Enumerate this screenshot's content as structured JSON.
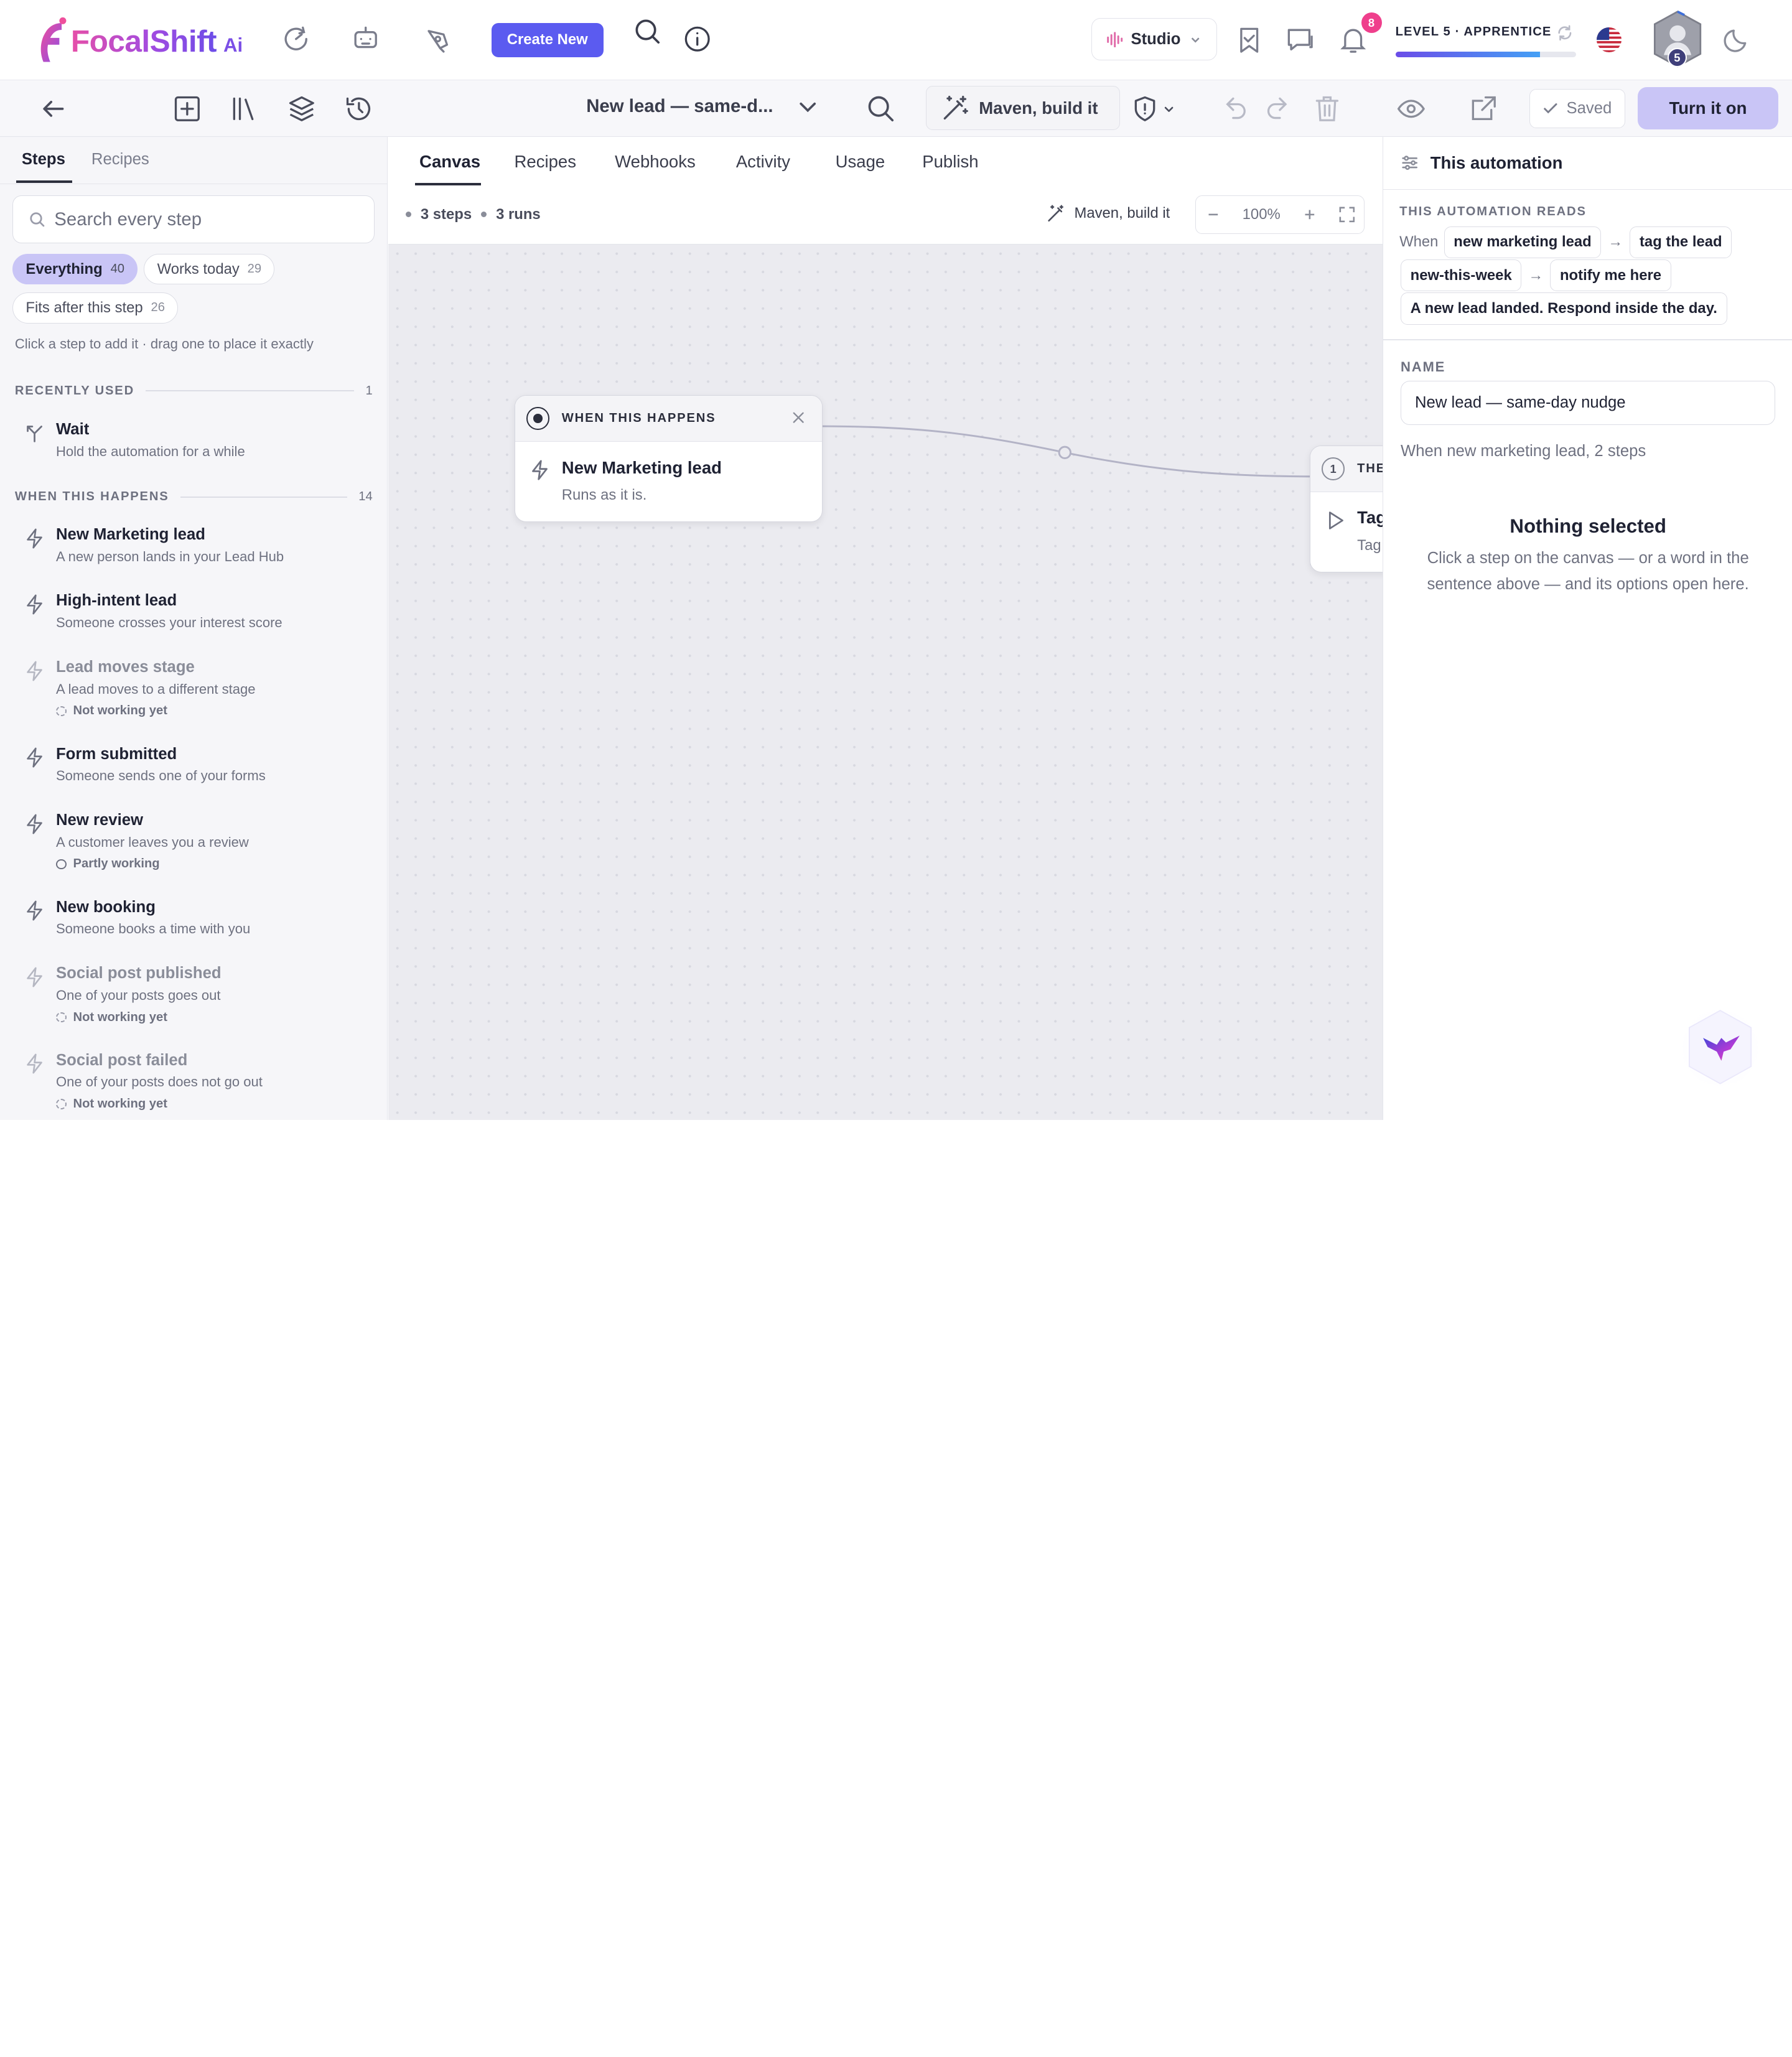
{
  "brand": {
    "name": "FocalShift",
    "suffix": "Ai"
  },
  "header": {
    "create_label": "Create New",
    "studio_label": "Studio",
    "notification_count": "8",
    "level_label": "LEVEL 5 · APPRENTICE",
    "level_progress": 0.8,
    "avatar_level": "5"
  },
  "toolbar": {
    "automation_name": "New lead — same-d...",
    "maven_label": "Maven, build it",
    "saved_label": "Saved",
    "turn_on_label": "Turn it on"
  },
  "sidebar": {
    "tabs": [
      "Steps",
      "Recipes"
    ],
    "search_placeholder": "Search every step",
    "filters": [
      {
        "label": "Everything",
        "count": "40"
      },
      {
        "label": "Works today",
        "count": "29"
      },
      {
        "label": "Fits after this step",
        "count": "26"
      }
    ],
    "hint": "Click a step to add it · drag one to place it exactly",
    "recent": {
      "title": "RECENTLY USED",
      "count": "1",
      "items": [
        {
          "name": "Wait",
          "desc": "Hold the automation for a while"
        }
      ]
    },
    "triggers": {
      "title": "WHEN THIS HAPPENS",
      "count": "14",
      "items": [
        {
          "name": "New Marketing lead",
          "desc": "A new person lands in your Lead Hub",
          "status": ""
        },
        {
          "name": "High-intent lead",
          "desc": "Someone crosses your interest score",
          "status": ""
        },
        {
          "name": "Lead moves stage",
          "desc": "A lead moves to a different stage",
          "status": "Not working yet"
        },
        {
          "name": "Form submitted",
          "desc": "Someone sends one of your forms",
          "status": ""
        },
        {
          "name": "New review",
          "desc": "A customer leaves you a review",
          "status": "Partly working"
        },
        {
          "name": "New booking",
          "desc": "Someone books a time with you",
          "status": ""
        },
        {
          "name": "Social post published",
          "desc": "One of your posts goes out",
          "status": "Not working yet"
        },
        {
          "name": "Social post failed",
          "desc": "One of your posts does not go out",
          "status": "Not working yet"
        }
      ]
    }
  },
  "center": {
    "tabs": [
      "Canvas",
      "Recipes",
      "Webhooks",
      "Activity",
      "Usage",
      "Publish"
    ],
    "steps_meta": "3 steps",
    "runs_meta": "3 runs",
    "maven_small": "Maven, build it",
    "zoom": "100%",
    "trigger_node": {
      "head": "WHEN THIS HAPPENS",
      "title": "New Marketing lead",
      "sub": "Runs as it is."
    },
    "then_node": {
      "index": "1",
      "head": "THE",
      "title": "Tag",
      "sub": "Tag"
    }
  },
  "right_panel": {
    "title": "This automation",
    "reads_title": "THIS AUTOMATION READS",
    "when_label": "When",
    "tokens": [
      "new marketing lead",
      "tag the lead",
      "new-this-week",
      "notify me here",
      "A new lead landed. Respond inside the day."
    ],
    "arrow": "→",
    "name_label": "NAME",
    "name_value": "New lead — same-day nudge",
    "name_summary": "When new marketing lead, 2 steps",
    "nothing_title": "Nothing selected",
    "nothing_desc": "Click a step on the canvas — or a word in the sentence above — and its options open here."
  }
}
